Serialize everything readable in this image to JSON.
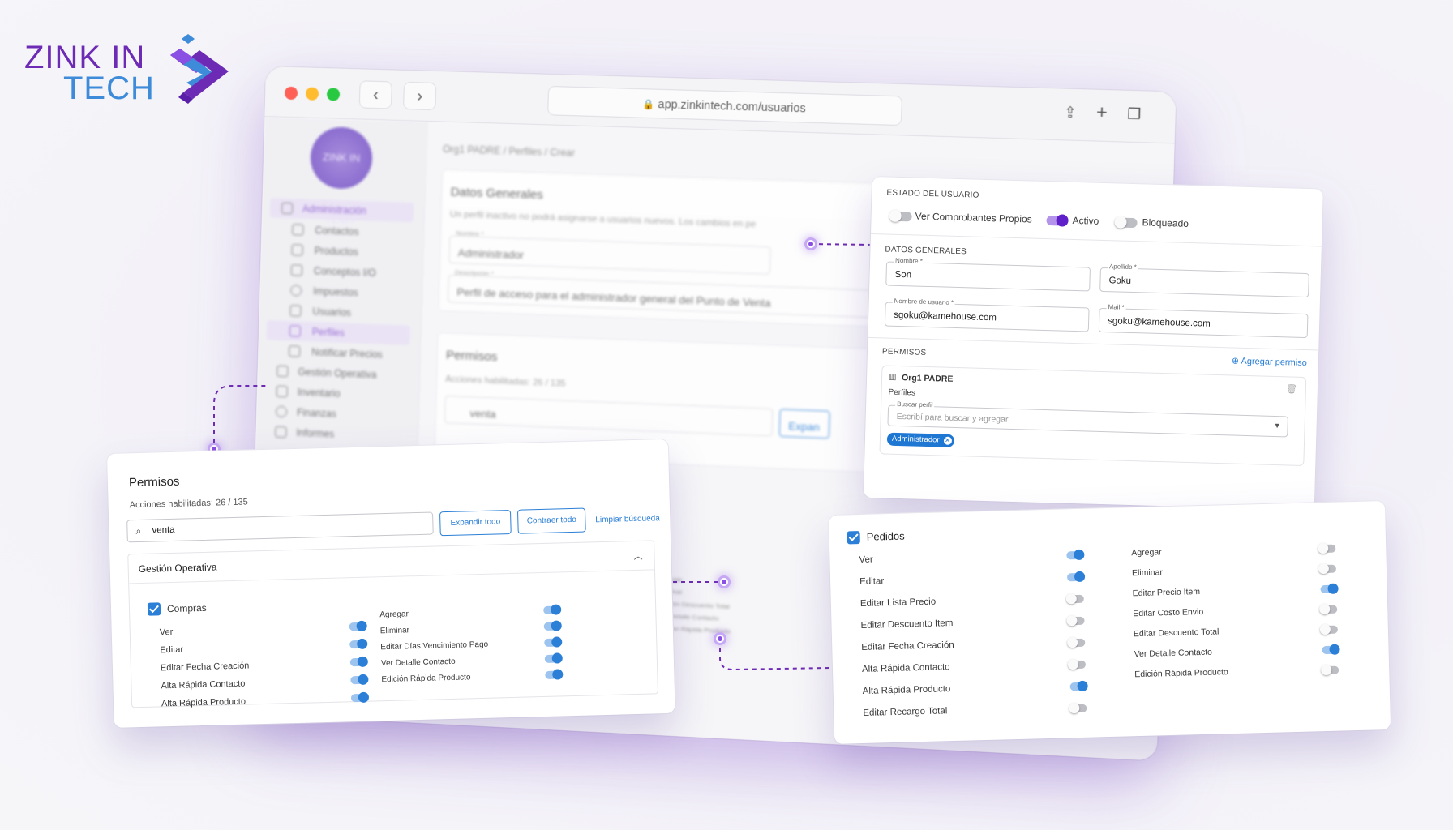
{
  "logo": {
    "line1": "ZINK IN",
    "line2": "TECH"
  },
  "browser": {
    "url": "app.zinkintech.com/usuarios",
    "back": "‹",
    "forward": "›",
    "icons": [
      "share-icon",
      "plus-icon",
      "tabs-icon"
    ]
  },
  "background_app": {
    "logo_text": "ZINK IN TECH",
    "breadcrumb": "Org1 PADRE  /  Perfiles  /  Crear",
    "sidebar": [
      {
        "label": "Administración",
        "active": true
      },
      {
        "label": "Contactos"
      },
      {
        "label": "Productos"
      },
      {
        "label": "Conceptos I/O"
      },
      {
        "label": "Impuestos"
      },
      {
        "label": "Usuarios"
      },
      {
        "label": "Perfiles",
        "active": true
      },
      {
        "label": "Notificar Precios"
      },
      {
        "label": "Gestión Operativa"
      },
      {
        "label": "Inventario"
      },
      {
        "label": "Finanzas"
      },
      {
        "label": "Informes"
      }
    ],
    "datos_title": "Datos Generales",
    "datos_sub": "Un perfil inactivo no podrá asignarse a usuarios nuevos. Los cambios en pe",
    "nombre_label": "Nombre *",
    "nombre_value": "Administrador",
    "descripcion_label": "Descripción *",
    "descripcion_value": "Perfil de acceso para el administrador general del Punto de Venta",
    "permisos_title": "Permisos",
    "permisos_sub": "Acciones habilitadas: 26 / 135",
    "search_value": "venta",
    "expand_partial": "Expan",
    "mini_list": [
      "Agregar",
      "Eliminar",
      "Edición Descuento Total",
      "Ver Detalle Contacto",
      "Edición Rápida Producto"
    ]
  },
  "user_card": {
    "estado_title": "ESTADO DEL USUARIO",
    "toggles": [
      {
        "label": "Ver Comprobantes Propios",
        "on": false
      },
      {
        "label": "Activo",
        "on": true
      },
      {
        "label": "Bloqueado",
        "on": false
      }
    ],
    "datos_title": "DATOS GENERALES",
    "fields": [
      {
        "label": "Nombre *",
        "value": "Son"
      },
      {
        "label": "Apellido *",
        "value": "Goku"
      },
      {
        "label": "Nombre de usuario *",
        "value": "sgoku@kamehouse.com"
      },
      {
        "label": "Mail *",
        "value": "sgoku@kamehouse.com"
      }
    ],
    "permisos_title": "PERMISOS",
    "agregar_permiso": "Agregar permiso",
    "org": "Org1 PADRE",
    "perfiles_label": "Perfiles",
    "buscar_label": "Buscar perfil",
    "buscar_placeholder": "Escribí para buscar y agregar",
    "chip": "Administrador"
  },
  "perm_card": {
    "title": "Permisos",
    "subtitle": "Acciones habilitadas: 26 / 135",
    "search_value": "venta",
    "expand": "Expandir todo",
    "collapse": "Contraer todo",
    "clear": "Limpiar búsqueda",
    "section": "Gestión Operativa",
    "group": "Compras",
    "left": [
      {
        "label": "Ver",
        "on": true
      },
      {
        "label": "Editar",
        "on": true
      },
      {
        "label": "Editar Fecha Creación",
        "on": true
      },
      {
        "label": "Alta Rápida Contacto",
        "on": true
      },
      {
        "label": "Alta Rápida Producto",
        "on": true
      }
    ],
    "right": [
      {
        "label": "Agregar",
        "on": true
      },
      {
        "label": "Eliminar",
        "on": true
      },
      {
        "label": "Editar Días Vencimiento Pago",
        "on": true
      },
      {
        "label": "Ver Detalle Contacto",
        "on": true
      },
      {
        "label": "Edición Rápida Producto",
        "on": true
      }
    ]
  },
  "pedidos_card": {
    "title": "Pedidos",
    "left": [
      {
        "label": "Ver",
        "on": true
      },
      {
        "label": "Editar",
        "on": true
      },
      {
        "label": "Editar Lista Precio",
        "on": false
      },
      {
        "label": "Editar Descuento Item",
        "on": false
      },
      {
        "label": "Editar Fecha Creación",
        "on": false
      },
      {
        "label": "Alta Rápida Contacto",
        "on": false
      },
      {
        "label": "Alta Rápida Producto",
        "on": true
      },
      {
        "label": "Editar Recargo Total",
        "on": false
      }
    ],
    "right": [
      {
        "label": "Agregar",
        "on": false
      },
      {
        "label": "Eliminar",
        "on": false
      },
      {
        "label": "Editar Precio Item",
        "on": true
      },
      {
        "label": "Editar Costo Envio",
        "on": false
      },
      {
        "label": "Editar Descuento Total",
        "on": false
      },
      {
        "label": "Ver Detalle Contacto",
        "on": true
      },
      {
        "label": "Edición Rápida Producto",
        "on": false
      }
    ]
  },
  "colors": {
    "brand_purple": "#6d2bb5",
    "brand_blue": "#3d8bd9",
    "accent_blue": "#2b7fd6",
    "toggle_purple": "#5f1fc9"
  }
}
